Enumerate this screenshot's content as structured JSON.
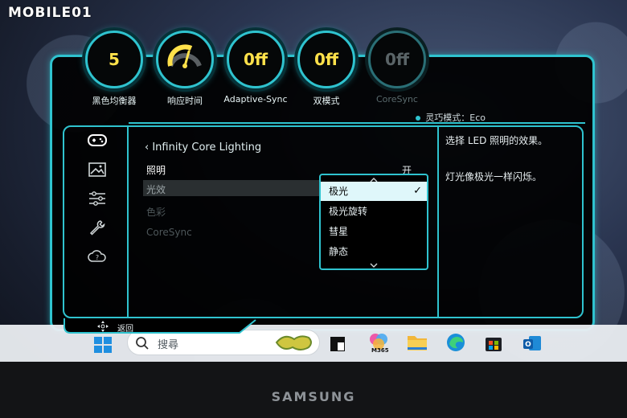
{
  "watermark": "MOBILE01",
  "colors": {
    "accent": "#2fc3cf",
    "value_yellow": "#ffe14a",
    "dim": "#5a6467",
    "selected_bg": "#dff7fa"
  },
  "dials": [
    {
      "value": "5",
      "label": "黑色均衡器",
      "dim": false
    },
    {
      "value": "",
      "label": "响应时间",
      "dim": false,
      "icon": "gauge-icon"
    },
    {
      "value": "0ff",
      "label": "Adaptive-Sync",
      "dim": false
    },
    {
      "value": "0ff",
      "label": "双模式",
      "dim": false
    },
    {
      "value": "0ff",
      "label": "CoreSync",
      "dim": true
    }
  ],
  "eco_mode": "灵巧模式：Eco",
  "sidebar_icons": [
    "gamepad-icon",
    "picture-icon",
    "sliders-icon",
    "wrench-icon",
    "help-cloud-icon"
  ],
  "breadcrumb": "Infinity Core Lighting",
  "menu": [
    {
      "label": "照明",
      "state": "active"
    },
    {
      "label": "光效",
      "state": "selected"
    },
    {
      "label": "色彩",
      "state": "dim"
    },
    {
      "label": "CoreSync",
      "state": "dim"
    }
  ],
  "lighting_value": "开",
  "dropdown": {
    "options": [
      "极光",
      "极光旋转",
      "彗星",
      "静态"
    ],
    "selected_index": 0
  },
  "description": {
    "line1": "选择 LED 照明的效果。",
    "line2": "灯光像极光一样闪烁。"
  },
  "back_label": "返回",
  "taskbar": {
    "search_placeholder": "搜尋",
    "icons": [
      "windows-start-icon",
      "search-icon",
      "widget-icon",
      "task-view-icon",
      "m365-icon",
      "file-explorer-icon",
      "edge-icon",
      "store-icon",
      "outlook-icon"
    ],
    "m365_label": "M365"
  },
  "brand": "SAMSUNG"
}
